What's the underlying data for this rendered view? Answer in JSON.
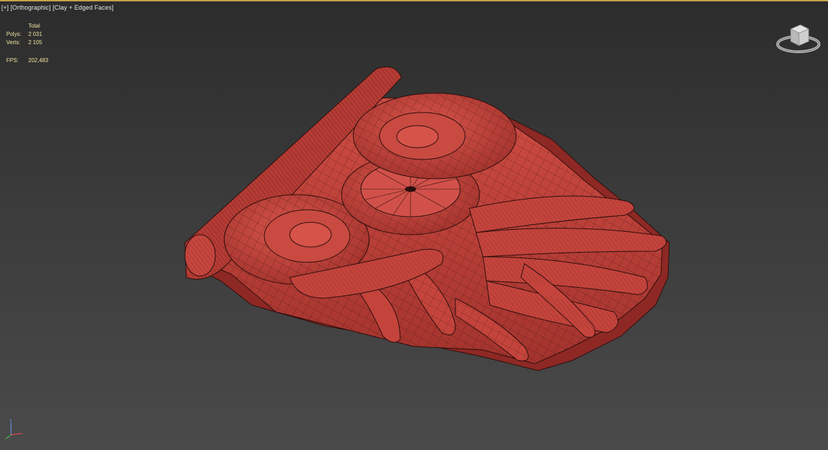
{
  "viewport": {
    "label_plus": "[+]",
    "label_view": "[Orthographic]",
    "label_shading": "[Clay + Edged Faces]"
  },
  "stats": {
    "header": "Total",
    "polys_label": "Polys:",
    "polys_value": "2 031",
    "verts_label": "Verts:",
    "verts_value": "2 105",
    "fps_label": "FPS:",
    "fps_value": "202,483"
  },
  "colors": {
    "clay": "#c0423b",
    "clay_dark": "#8e2824",
    "edge": "#2a0d0b",
    "stats_text": "#f2e3a0",
    "viewport_border": "#c8a24a"
  },
  "icons": {
    "viewcube": "viewcube-icon",
    "axis": "axis-tripod-icon"
  }
}
